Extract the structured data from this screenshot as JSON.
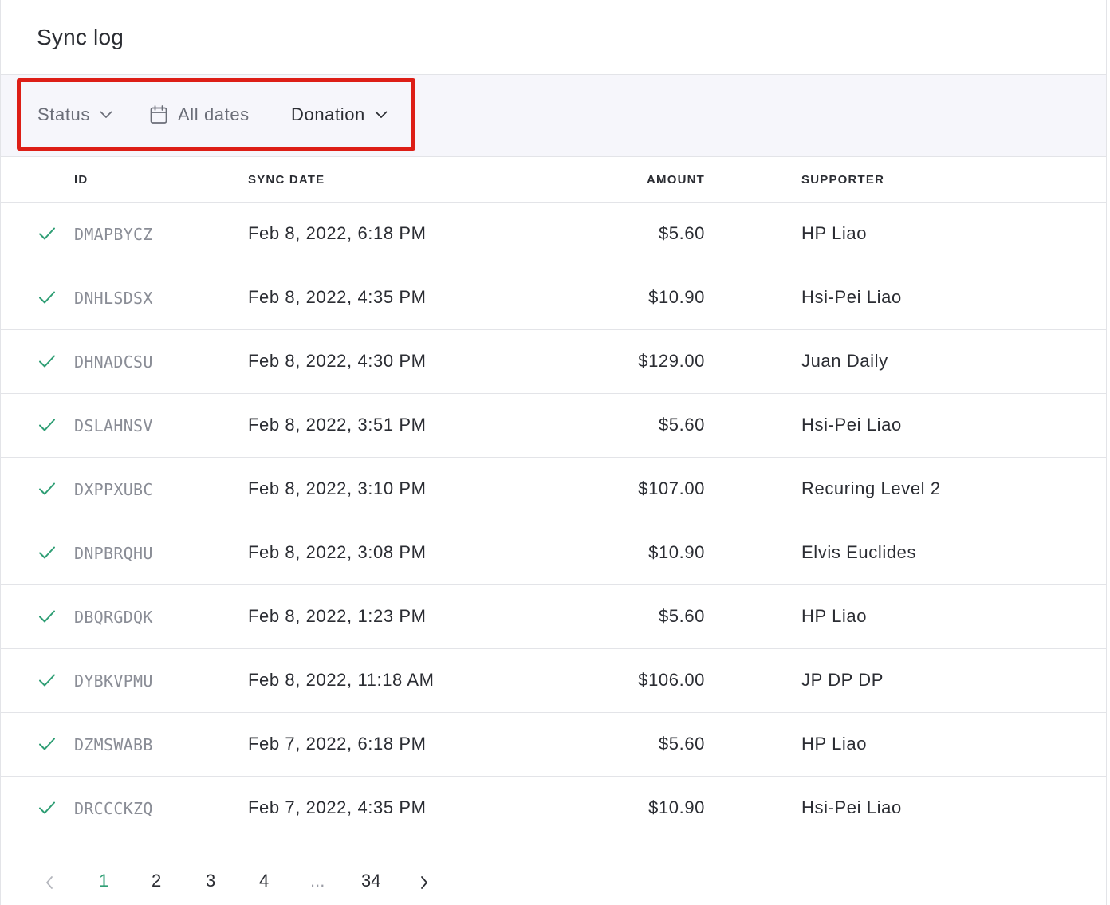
{
  "page": {
    "title": "Sync log"
  },
  "filters": {
    "status_label": "Status",
    "dates_label": "All dates",
    "type_label": "Donation"
  },
  "table": {
    "headers": {
      "id": "ID",
      "sync_date": "SYNC DATE",
      "amount": "AMOUNT",
      "supporter": "SUPPORTER"
    },
    "rows": [
      {
        "id": "DMAPBYCZ",
        "date": "Feb 8, 2022, 6:18 PM",
        "amount": "$5.60",
        "supporter": "HP Liao"
      },
      {
        "id": "DNHLSDSX",
        "date": "Feb 8, 2022, 4:35 PM",
        "amount": "$10.90",
        "supporter": "Hsi-Pei Liao"
      },
      {
        "id": "DHNADCSU",
        "date": "Feb 8, 2022, 4:30 PM",
        "amount": "$129.00",
        "supporter": "Juan Daily"
      },
      {
        "id": "DSLAHNSV",
        "date": "Feb 8, 2022, 3:51 PM",
        "amount": "$5.60",
        "supporter": "Hsi-Pei Liao"
      },
      {
        "id": "DXPPXUBC",
        "date": "Feb 8, 2022, 3:10 PM",
        "amount": "$107.00",
        "supporter": "Recuring Level 2"
      },
      {
        "id": "DNPBRQHU",
        "date": "Feb 8, 2022, 3:08 PM",
        "amount": "$10.90",
        "supporter": "Elvis Euclides"
      },
      {
        "id": "DBQRGDQK",
        "date": "Feb 8, 2022, 1:23 PM",
        "amount": "$5.60",
        "supporter": "HP Liao"
      },
      {
        "id": "DYBKVPMU",
        "date": "Feb 8, 2022, 11:18 AM",
        "amount": "$106.00",
        "supporter": "JP DP DP"
      },
      {
        "id": "DZMSWABB",
        "date": "Feb 7, 2022, 6:18 PM",
        "amount": "$5.60",
        "supporter": "HP Liao"
      },
      {
        "id": "DRCCCKZQ",
        "date": "Feb 7, 2022, 4:35 PM",
        "amount": "$10.90",
        "supporter": "Hsi-Pei Liao"
      }
    ]
  },
  "pagination": {
    "pages": [
      "1",
      "2",
      "3",
      "4"
    ],
    "ellipsis": "...",
    "last_page": "34",
    "current": "1"
  },
  "colors": {
    "accent": "#2e9e74",
    "highlight": "#dd1e16",
    "filter_bg": "#f6f6fb"
  },
  "icons": {
    "status": "check-icon",
    "calendar": "calendar-icon",
    "dropdown": "chevron-down-icon",
    "prev": "chevron-left-icon",
    "next": "chevron-right-icon"
  }
}
